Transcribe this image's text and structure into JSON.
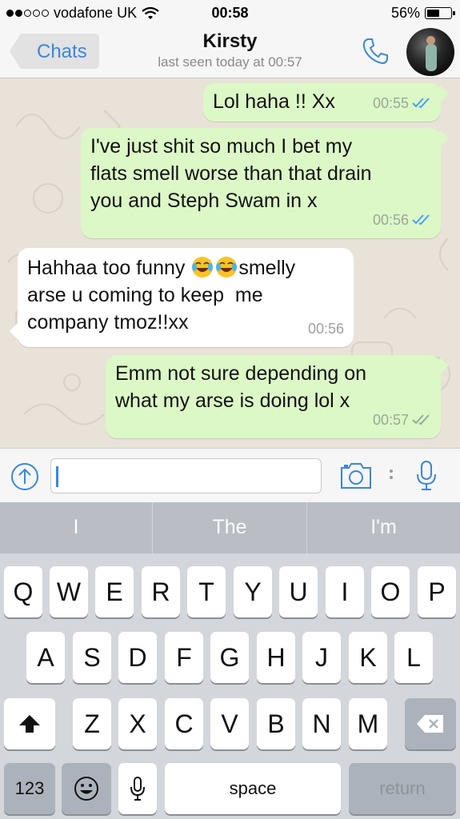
{
  "status_bar": {
    "carrier": "vodafone UK",
    "time": "00:58",
    "battery": "56%",
    "battery_level": 0.56
  },
  "nav": {
    "back_label": "Chats",
    "contact_name": "Kirsty",
    "last_seen": "last seen today at 00:57",
    "icons": [
      "call-icon",
      "avatar"
    ]
  },
  "messages": [
    {
      "direction": "out",
      "text": "Lol haha !! Xx",
      "time": "00:55",
      "status": "read"
    },
    {
      "direction": "out",
      "lines": [
        "I've just shit so much I bet my",
        "flats smell worse than that drain",
        "you and Steph Swam in x"
      ],
      "time": "00:56",
      "status": "read"
    },
    {
      "direction": "in",
      "lines": [
        "Hahhaa too funny",
        "smelly",
        "arse u coming to keep  me",
        "company tmoz!!xx"
      ],
      "time": "00:56"
    },
    {
      "direction": "out",
      "lines": [
        "Emm not sure depending on",
        "what my arse is doing lol x"
      ],
      "time": "00:57",
      "status": "delivered"
    }
  ],
  "input": {
    "value": "",
    "placeholder": ""
  },
  "keyboard": {
    "suggestions": [
      "I",
      "The",
      "I'm"
    ],
    "row1": [
      "Q",
      "W",
      "E",
      "R",
      "T",
      "Y",
      "U",
      "I",
      "O",
      "P"
    ],
    "row2": [
      "A",
      "S",
      "D",
      "F",
      "G",
      "H",
      "J",
      "K",
      "L"
    ],
    "row3": [
      "Z",
      "X",
      "C",
      "V",
      "B",
      "N",
      "M"
    ],
    "numbers_label": "123",
    "space_label": "space",
    "return_label": "return"
  },
  "colors": {
    "accent": "#3b87d8",
    "outgoing_bubble": "#dcf8c6",
    "incoming_bubble": "#ffffff",
    "read_ticks": "#4a9ff5",
    "chat_background": "#e8e2d8"
  }
}
